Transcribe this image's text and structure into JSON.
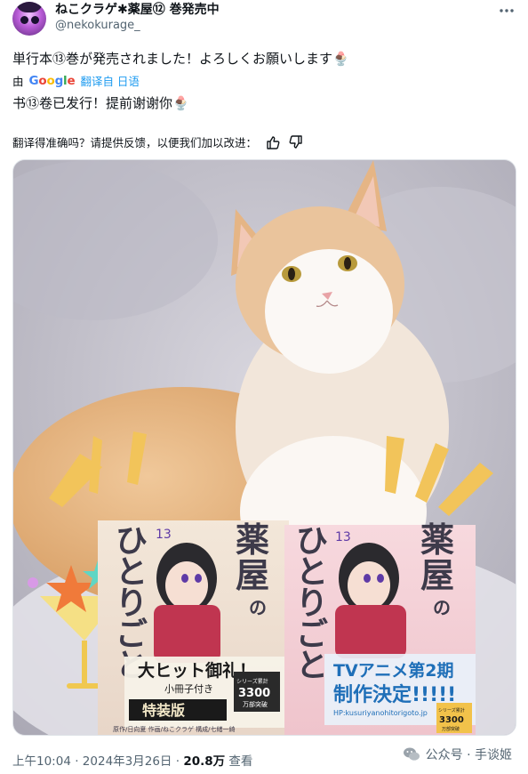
{
  "author": {
    "name": "ねこクラゲ✱薬屋⑫ 巻発売中",
    "handle": "@nekokurage_",
    "more_icon": "more-icon"
  },
  "tweet": {
    "original_text": "単行本⑬巻が発売されました！よろしくお願いします🍨",
    "translated_by_prefix": "由",
    "translated_by_brand": "Google",
    "translated_from": "翻译自 日语",
    "translated_text": "书⑬卷已发行！提前谢谢你🍨",
    "feedback_prompt": "翻译得准确吗？请提供反馈，以便我们加以改进："
  },
  "photo": {
    "book_left": {
      "title": "薬屋のひとりごと",
      "volume": "13",
      "band_main": "大ヒット御礼！",
      "band_sub": "小冊子付き",
      "edition": "特装版",
      "badge": "シリーズ累計3300万部突破",
      "badge_line1": "シリーズ累計",
      "badge_line2": "3300",
      "badge_line3": "万部突破",
      "credits": "原作/日向夏 作画/ねこクラゲ 構成/七緒一綺"
    },
    "book_right": {
      "title": "薬屋のひとりごと",
      "volume": "13",
      "band_main": "TVアニメ第2期",
      "band_sub": "制作決定!!!!!",
      "url": "HP:kusuriyanohitorigoto.jp",
      "badge_line1": "シリーズ累計",
      "badge_line2": "3300",
      "badge_line3": "万部突破"
    }
  },
  "meta": {
    "time": "上午10:04",
    "date": "2024年3月26日",
    "views": "20.8万",
    "views_label": "查看"
  },
  "watermark": {
    "text": "公众号 · 手谈姬"
  },
  "colors": {
    "link_blue": "#1d9bf0",
    "muted": "#536471",
    "text": "#0f1419"
  }
}
